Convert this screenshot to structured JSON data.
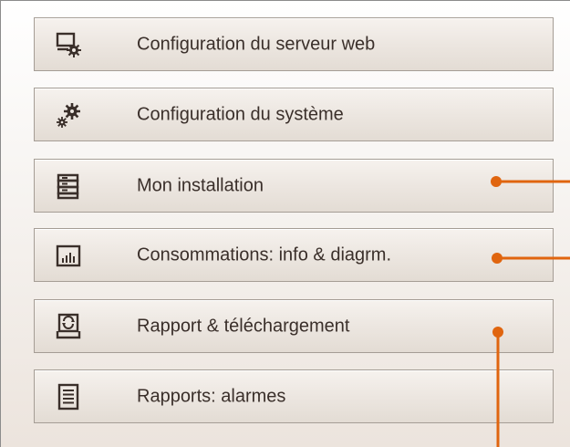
{
  "menu": {
    "items": [
      {
        "label": "Configuration du serveur web",
        "icon": "web-server-settings-icon"
      },
      {
        "label": "Configuration du système",
        "icon": "system-gears-icon"
      },
      {
        "label": "Mon installation",
        "icon": "installation-stack-icon"
      },
      {
        "label": "Consommations: info & diagrm.",
        "icon": "consumption-chart-icon"
      },
      {
        "label": "Rapport & téléchargement",
        "icon": "report-download-icon"
      },
      {
        "label": "Rapports: alarmes",
        "icon": "alarm-report-icon"
      }
    ]
  },
  "colors": {
    "callout": "#e0650f",
    "icon": "#3a2f2a",
    "text": "#3a2f2a",
    "button_border": "#a59d95"
  }
}
